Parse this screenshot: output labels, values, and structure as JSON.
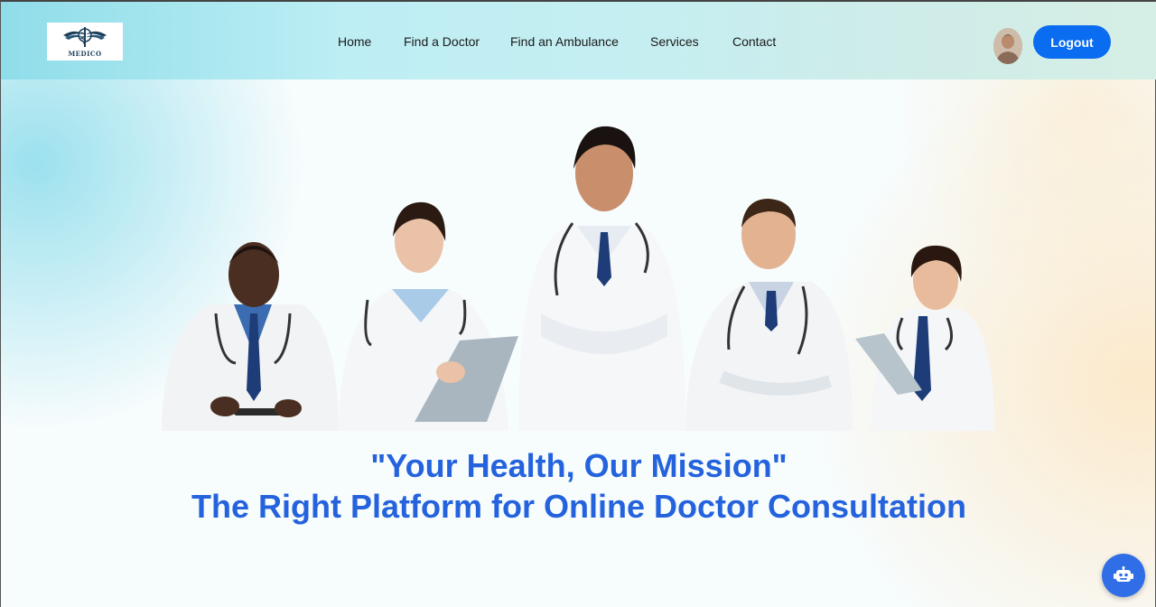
{
  "brand": {
    "logo_text": "MEDICO",
    "icon": "caduceus-icon"
  },
  "nav": {
    "links": [
      {
        "label": "Home"
      },
      {
        "label": "Find a Doctor"
      },
      {
        "label": "Find an Ambulance"
      },
      {
        "label": "Services"
      },
      {
        "label": "Contact"
      }
    ]
  },
  "user": {
    "avatar_icon": "user-avatar-icon",
    "logout_label": "Logout"
  },
  "hero": {
    "image_icon": "doctors-group-photo",
    "tagline": "\"Your Health, Our Mission\"",
    "headline": "The Right Platform for Online Doctor Consultation"
  },
  "chatbot": {
    "icon": "robot-icon"
  },
  "colors": {
    "accent": "#0a6cf0",
    "headline": "#2463dd",
    "nav_text": "#1a1a1a",
    "chatbot": "#2f6ee6"
  }
}
